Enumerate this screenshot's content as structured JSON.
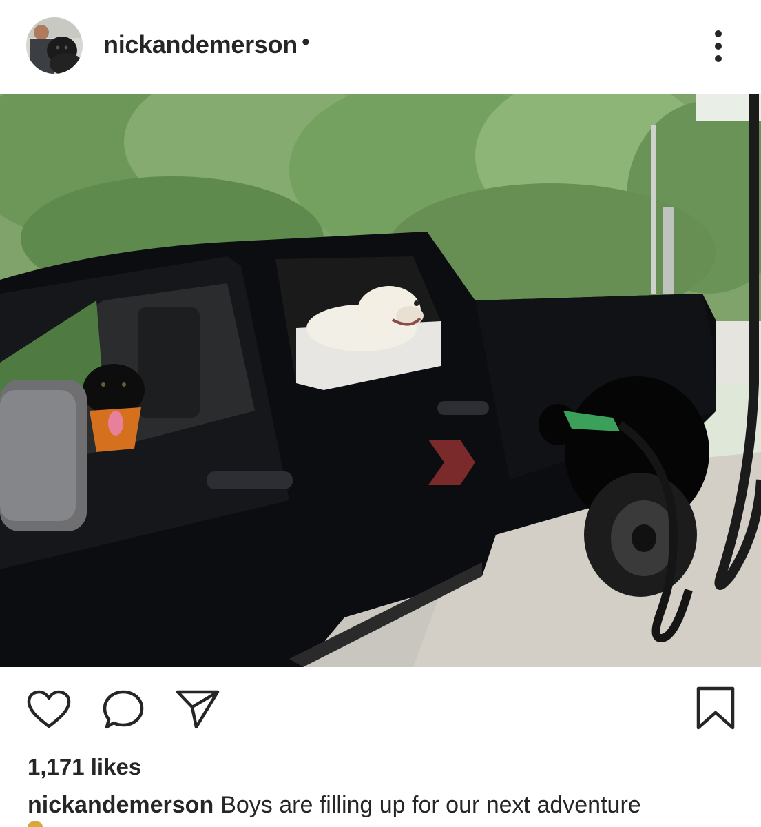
{
  "post": {
    "username": "nickandemerson",
    "separator": "•",
    "more_menu_icon": "more-vertical-icon",
    "photo_alt": "Two dogs in a black pickup truck at a gas pump",
    "likes_text": "1,171 likes",
    "caption": {
      "username": "nickandemerson",
      "text": "Boys are filling up for our next adventure"
    },
    "actions": {
      "like_icon": "heart-icon",
      "comment_icon": "comment-icon",
      "share_icon": "share-icon",
      "save_icon": "bookmark-icon"
    }
  },
  "colors": {
    "text": "#262626",
    "background": "#ffffff"
  }
}
